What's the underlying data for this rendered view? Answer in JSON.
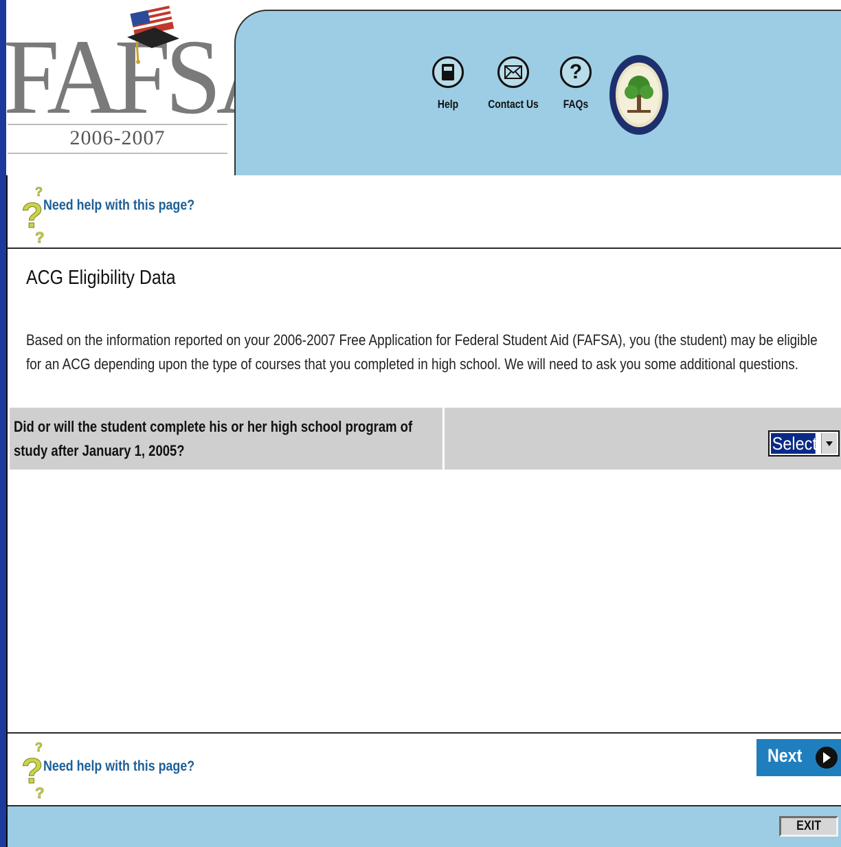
{
  "colors": {
    "brand_blue": "#1c3a9c",
    "banner": "#9ccde4",
    "link": "#1d5f97",
    "question_bg": "#cfcfcf",
    "next_button": "#1f7fbe"
  },
  "logo": {
    "text": "FAFSA",
    "year": "2006-2007"
  },
  "nav": [
    {
      "icon": "book-icon",
      "label": "Help"
    },
    {
      "icon": "envelope-icon",
      "label": "Contact Us"
    },
    {
      "icon": "question-icon",
      "label": "FAQs"
    }
  ],
  "help_link": "Need help with this page?",
  "page_title": "ACG Eligibility Data",
  "intro": "Based on the information reported on your 2006-2007 Free Application for Federal Student Aid (FAFSA), you (the student) may be eligible for an ACG depending upon the type of courses that you completed in high school. We will need to ask you some additional questions.",
  "question": {
    "text": "Did or will the student complete his or her high school program of study after January 1, 2005?",
    "select_value": "Select"
  },
  "buttons": {
    "next": "Next",
    "exit": "EXIT"
  }
}
